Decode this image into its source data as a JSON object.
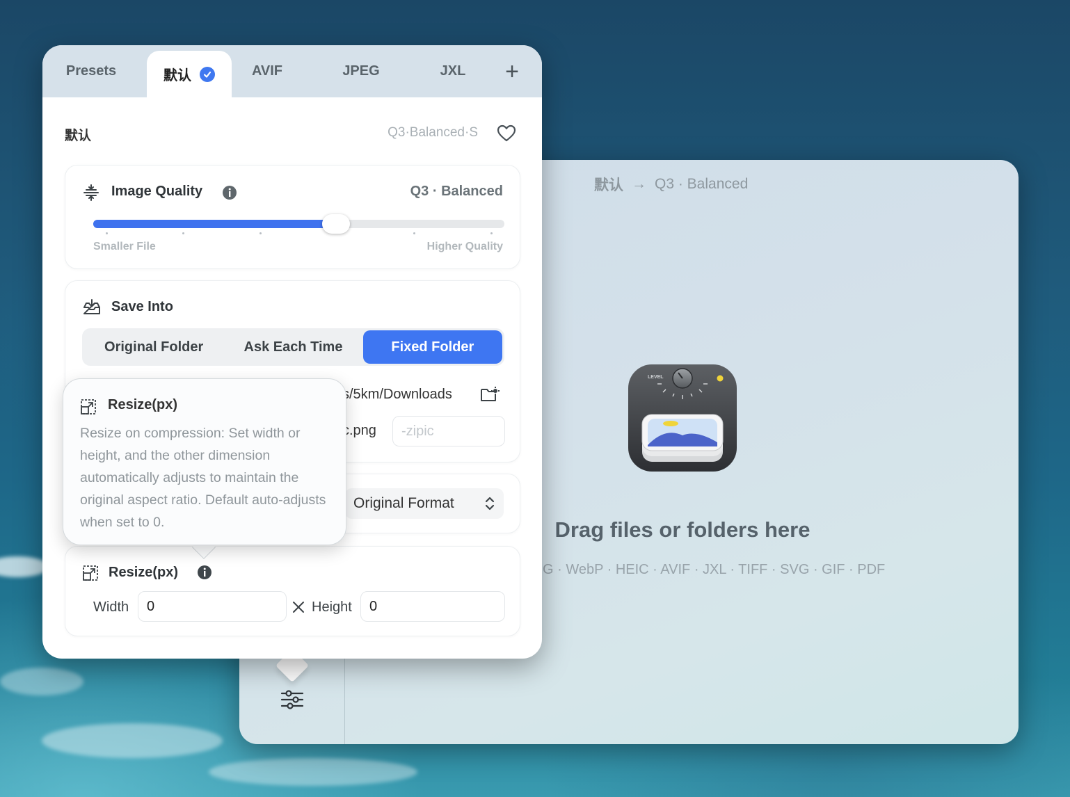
{
  "presets_popover": {
    "tabs": [
      {
        "label": "Presets"
      },
      {
        "label": "默认",
        "selected": true
      },
      {
        "label": "AVIF"
      },
      {
        "label": "JPEG"
      },
      {
        "label": "JXL"
      }
    ],
    "add_tab_label": "+",
    "preset_name": "默认",
    "preset_summary": "Q3·Balanced·S",
    "image_quality": {
      "title": "Image Quality",
      "value_label": "Q3 · Balanced",
      "level_fraction": 0.59,
      "min_label": "Smaller File",
      "max_label": "Higher Quality"
    },
    "save_into": {
      "title": "Save Into",
      "options": [
        "Original Folder",
        "Ask Each Time",
        "Fixed Folder"
      ],
      "selected": "Fixed Folder",
      "folder_path_visible": "s/5km/Downloads",
      "filename_visible": "c.png",
      "suffix_placeholder": "-zipic"
    },
    "format": {
      "selected": "Original Format"
    },
    "resize": {
      "title": "Resize(px)",
      "width_label": "Width",
      "width_value": "0",
      "height_label": "Height",
      "height_value": "0"
    }
  },
  "tooltip": {
    "title": "Resize(px)",
    "body": "Resize on compression: Set width or height, and the other dimension automatically adjusts to maintain the original aspect ratio. Default auto-adjusts when set to 0."
  },
  "main_window": {
    "breadcrumb_preset": "默认",
    "breadcrumb_arrow": "→",
    "breadcrumb_quality": "Q3 · Balanced",
    "drop_title": "Drag files or folders here",
    "formats_visible": "G · WebP · HEIC · AVIF · JXL · TIFF · SVG · GIF · PDF"
  },
  "colors": {
    "accent": "#3f72ee",
    "window_bg": "#d4e1ea",
    "tabbar_bg": "#d6e1ea"
  },
  "icons": [
    "quality-icon",
    "info-icon",
    "save-into-icon",
    "folder-settings-icon",
    "resize-icon",
    "heart-icon",
    "check-badge-icon",
    "sliders-icon",
    "app-icon",
    "times-icon",
    "chevron-updown-icon"
  ]
}
